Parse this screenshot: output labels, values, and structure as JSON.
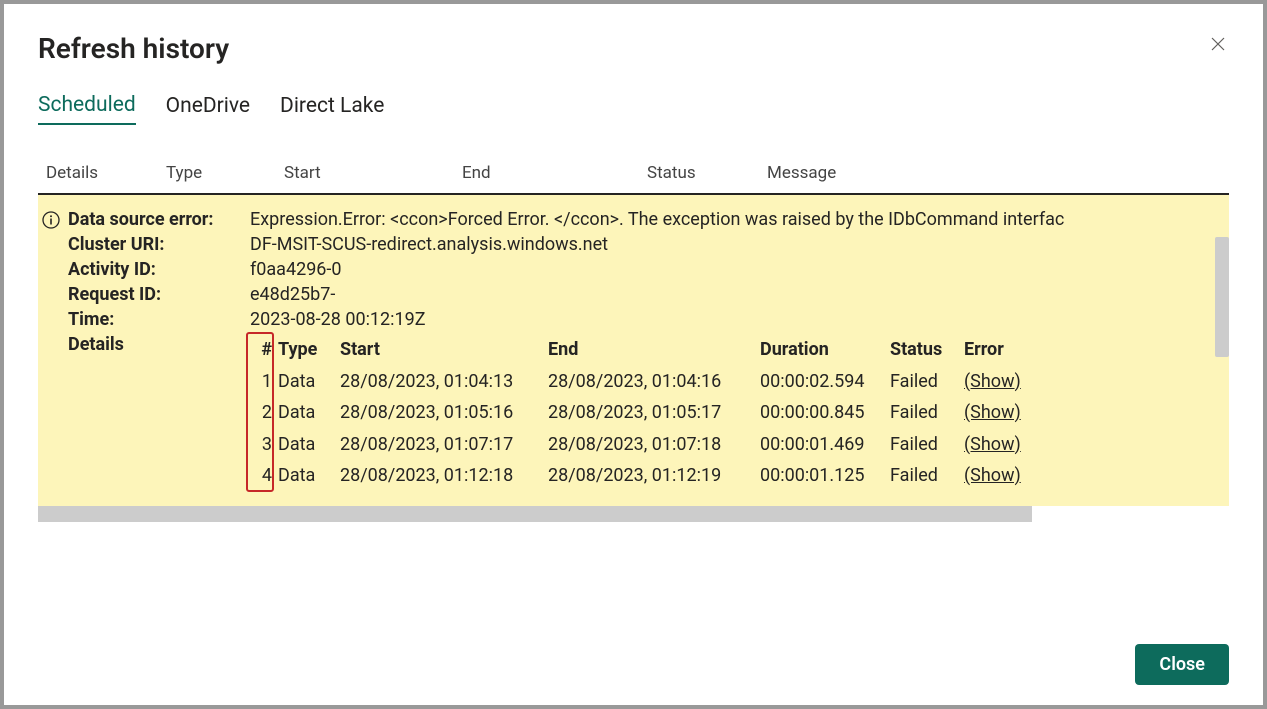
{
  "dialog": {
    "title": "Refresh history",
    "close_label": "Close"
  },
  "tabs": [
    {
      "label": "Scheduled",
      "active": true
    },
    {
      "label": "OneDrive",
      "active": false
    },
    {
      "label": "Direct Lake",
      "active": false
    }
  ],
  "columns": {
    "details": "Details",
    "type": "Type",
    "start": "Start",
    "end": "End",
    "status": "Status",
    "message": "Message"
  },
  "error": {
    "labels": {
      "data_source_error": "Data source error:",
      "cluster_uri": "Cluster URI:",
      "activity_id": "Activity ID:",
      "request_id": "Request ID:",
      "time": "Time:",
      "details": "Details"
    },
    "values": {
      "data_source_error": "Expression.Error: <ccon>Forced Error. </ccon>. The exception was raised by the IDbCommand interfac",
      "cluster_uri": "DF-MSIT-SCUS-redirect.analysis.windows.net",
      "activity_id": "f0aa4296-0",
      "request_id": "e48d25b7-",
      "time": "2023-08-28 00:12:19Z"
    },
    "detail_columns": {
      "num": "#",
      "type": "Type",
      "start": "Start",
      "end": "End",
      "duration": "Duration",
      "status": "Status",
      "error": "Error"
    },
    "detail_rows": [
      {
        "num": "1",
        "type": "Data",
        "start": "28/08/2023, 01:04:13",
        "end": "28/08/2023, 01:04:16",
        "duration": "00:00:02.594",
        "status": "Failed",
        "error": "(Show)"
      },
      {
        "num": "2",
        "type": "Data",
        "start": "28/08/2023, 01:05:16",
        "end": "28/08/2023, 01:05:17",
        "duration": "00:00:00.845",
        "status": "Failed",
        "error": "(Show)"
      },
      {
        "num": "3",
        "type": "Data",
        "start": "28/08/2023, 01:07:17",
        "end": "28/08/2023, 01:07:18",
        "duration": "00:00:01.469",
        "status": "Failed",
        "error": "(Show)"
      },
      {
        "num": "4",
        "type": "Data",
        "start": "28/08/2023, 01:12:18",
        "end": "28/08/2023, 01:12:19",
        "duration": "00:00:01.125",
        "status": "Failed",
        "error": "(Show)"
      }
    ]
  }
}
